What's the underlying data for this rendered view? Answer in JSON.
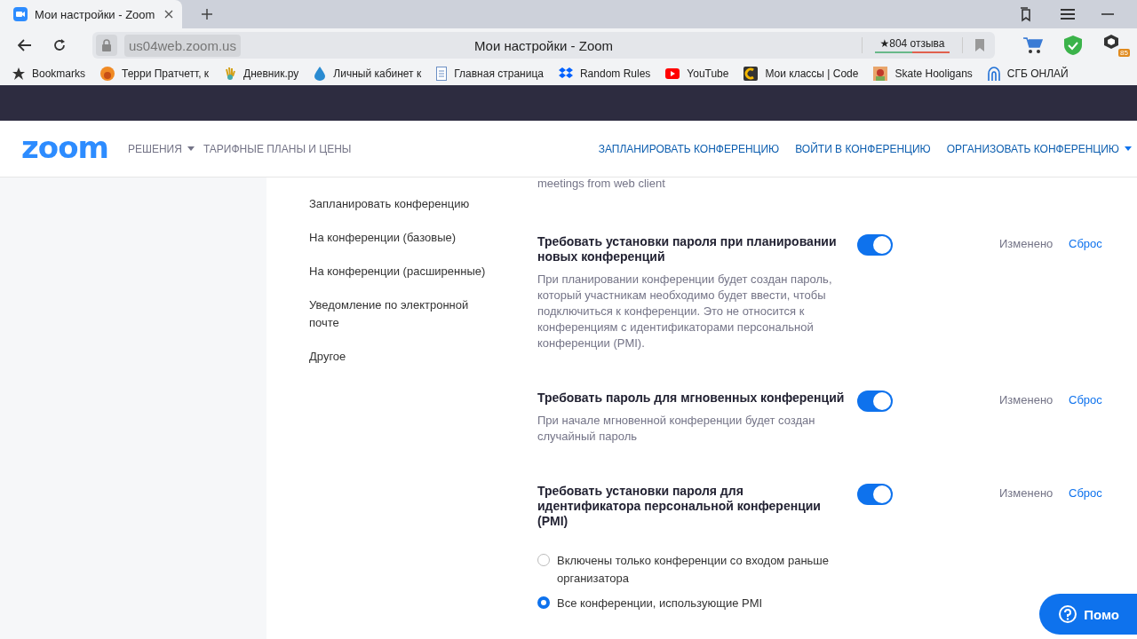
{
  "browser": {
    "tab_title": "Мои настройки - Zoom",
    "url": "us04web.zoom.us",
    "page_title": "Мои настройки - Zoom",
    "reviews": "★804 отзыва",
    "extension_badge": "85"
  },
  "bookmarks": [
    {
      "label": "Bookmarks",
      "kind": "star"
    },
    {
      "label": "Терри Пратчетт, к",
      "kind": "orange"
    },
    {
      "label": "Дневник.ру",
      "kind": "hand"
    },
    {
      "label": "Личный кабинет к",
      "kind": "drop"
    },
    {
      "label": "Главная страница",
      "kind": "doc"
    },
    {
      "label": "Random Rules",
      "kind": "dropbox"
    },
    {
      "label": "YouTube",
      "kind": "youtube"
    },
    {
      "label": "Мои классы | Code",
      "kind": "code"
    },
    {
      "label": "Skate Hooligans",
      "kind": "avatar"
    },
    {
      "label": "СГБ ОНЛАЙ",
      "kind": "arch"
    }
  ],
  "header": {
    "logo": "zoom",
    "nav_left": [
      {
        "label": "РЕШЕНИЯ",
        "dropdown": true
      },
      {
        "label": "ТАРИФНЫЕ ПЛАНЫ И ЦЕНЫ",
        "dropdown": false
      }
    ],
    "nav_right": [
      {
        "label": "ЗАПЛАНИРОВАТЬ КОНФЕРЕНЦИЮ",
        "dropdown": false
      },
      {
        "label": "ВОЙТИ В КОНФЕРЕНЦИЮ",
        "dropdown": false
      },
      {
        "label": "ОРГАНИЗОВАТЬ КОНФЕРЕНЦИЮ",
        "dropdown": true
      }
    ]
  },
  "sidebar": {
    "items": [
      "Запланировать конференцию",
      "На конференции (базовые)",
      "На конференции (расширенные)",
      "Уведомление по электронной почте",
      "Другое"
    ]
  },
  "previous_description_tail": "meetings from web client",
  "settings": [
    {
      "title": "Требовать установки пароля при планировании новых конференций",
      "description": "При планировании конференции будет создан пароль, который участникам необходимо будет ввести, чтобы подключиться к конференции. Это не относится к конференциям с идентификаторами персональной конференции (PMI).",
      "on": true,
      "status": "Изменено",
      "reset": "Сброс"
    },
    {
      "title": "Требовать пароль для мгновенных конференций",
      "description": "При начале мгновенной конференции будет создан случайный пароль",
      "on": true,
      "status": "Изменено",
      "reset": "Сброс"
    },
    {
      "title": "Требовать установки пароля для идентификатора персональной конференции (PMI)",
      "on": true,
      "status": "Изменено",
      "reset": "Сброс",
      "options": [
        {
          "label": "Включены только конференции со входом раньше организатора",
          "selected": false
        },
        {
          "label": "Все конференции, использующие PMI",
          "selected": true
        }
      ]
    }
  ],
  "help_button": "Помо"
}
